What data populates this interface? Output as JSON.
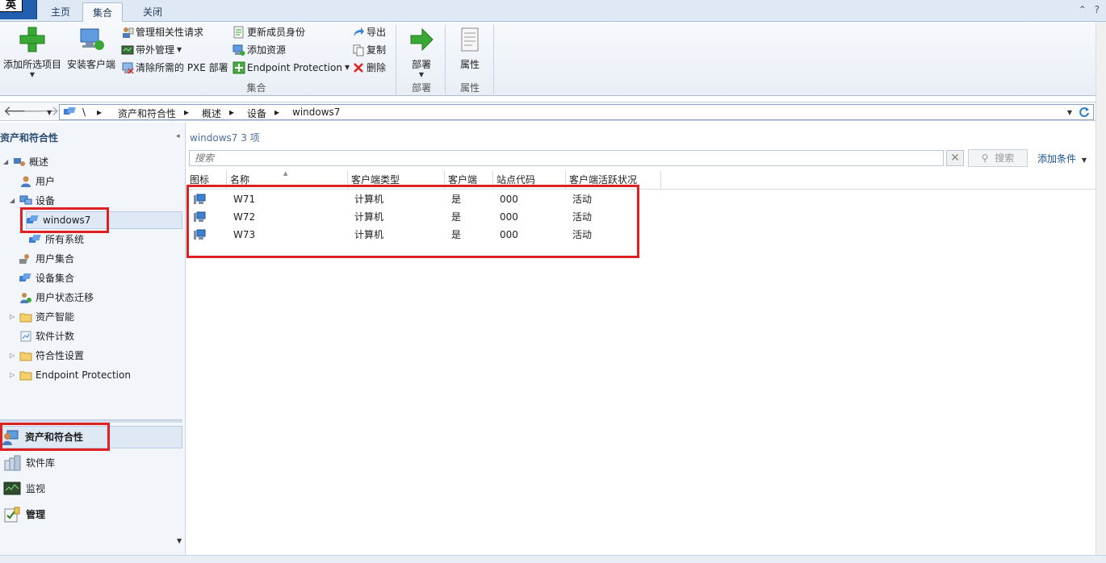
{
  "app_button": {
    "label": "英"
  },
  "tabs": [
    {
      "label": "主页",
      "active": false
    },
    {
      "label": "集合",
      "active": true
    },
    {
      "label": "关闭",
      "active": false
    }
  ],
  "tab_controls": {
    "collapse": "⌃",
    "help": "?"
  },
  "ribbon": {
    "add_selected": "添加所选项目",
    "install_client": "安装客户端",
    "manage_relationship_requests": "管理相关性请求",
    "out_of_band": "带外管理",
    "clear_pxe": "清除所需的 PXE 部署",
    "update_membership": "更新成员身份",
    "add_resources": "添加资源",
    "endpoint_protection": "Endpoint Protection",
    "export": "导出",
    "copy": "复制",
    "delete": "删除",
    "group_collection": "集合",
    "deploy": "部署",
    "group_deploy": "部署",
    "properties": "属性",
    "group_properties": "属性"
  },
  "breadcrumb": {
    "root": "\\",
    "items": [
      "资产和符合性",
      "概述",
      "设备",
      "windows7"
    ]
  },
  "nav": {
    "title": "资产和符合性",
    "tree": [
      {
        "label": "概述"
      },
      {
        "label": "用户"
      },
      {
        "label": "设备"
      },
      {
        "label": "windows7"
      },
      {
        "label": "所有系统"
      },
      {
        "label": "用户集合"
      },
      {
        "label": "设备集合"
      },
      {
        "label": "用户状态迁移"
      },
      {
        "label": "资产智能"
      },
      {
        "label": "软件计数"
      },
      {
        "label": "符合性设置"
      },
      {
        "label": "Endpoint Protection"
      }
    ],
    "workspaces": [
      {
        "label": "资产和符合性"
      },
      {
        "label": "软件库"
      },
      {
        "label": "监视"
      },
      {
        "label": "管理"
      }
    ]
  },
  "content": {
    "title": "windows7 3 项",
    "search_placeholder": "搜索",
    "search_button": "搜索",
    "add_criteria": "添加条件",
    "columns": [
      "图标",
      "名称",
      "客户端类型",
      "客户端",
      "站点代码",
      "客户端活跃状况"
    ],
    "rows": [
      {
        "name": "W71",
        "client_type": "计算机",
        "client": "是",
        "site_code": "000",
        "activity": "活动"
      },
      {
        "name": "W72",
        "client_type": "计算机",
        "client": "是",
        "site_code": "000",
        "activity": "活动"
      },
      {
        "name": "W73",
        "client_type": "计算机",
        "client": "是",
        "site_code": "000",
        "activity": "活动"
      }
    ]
  },
  "colors": {
    "highlight_box": "#e02020",
    "accent": "#1f5fae",
    "link": "#1b4f94"
  }
}
